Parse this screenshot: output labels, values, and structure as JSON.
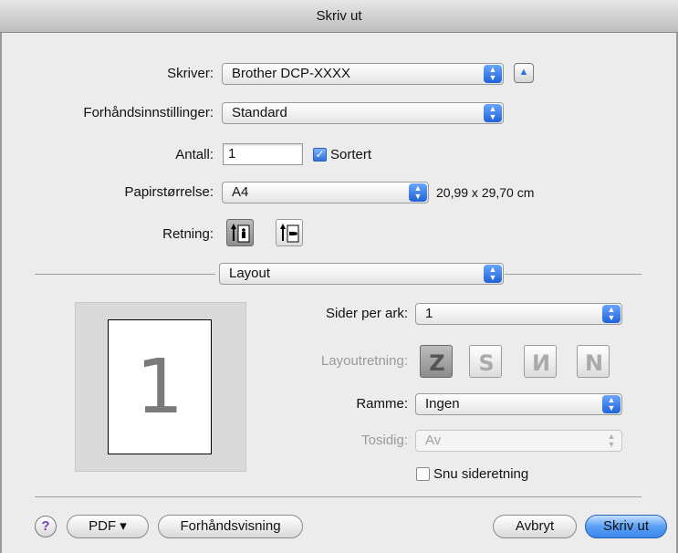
{
  "window": {
    "title": "Skriv ut"
  },
  "printer": {
    "label": "Skriver:",
    "value": "Brother DCP-XXXX"
  },
  "presets": {
    "label": "Forhåndsinnstillinger:",
    "value": "Standard"
  },
  "copies": {
    "label": "Antall:",
    "value": "1",
    "collate_label": "Sortert",
    "collated": true
  },
  "paper_size": {
    "label": "Papirstørrelse:",
    "value": "A4",
    "dimensions": "20,99 x 29,70 cm"
  },
  "orientation": {
    "label": "Retning:",
    "selected": "portrait"
  },
  "section": {
    "value": "Layout"
  },
  "pages_per_sheet": {
    "label": "Sider per ark:",
    "value": "1"
  },
  "layout_direction": {
    "label": "Layoutretning:",
    "selected_index": 0
  },
  "border": {
    "label": "Ramme:",
    "value": "Ingen"
  },
  "two_sided": {
    "label": "Tosidig:",
    "value": "Av"
  },
  "reverse_orientation": {
    "label": "Snu sideretning",
    "checked": false
  },
  "preview": {
    "page_number": "1"
  },
  "footer": {
    "help": "?",
    "pdf": "PDF ▾",
    "preview": "Forhåndsvisning",
    "cancel": "Avbryt",
    "print": "Skriv ut"
  },
  "icons": {
    "popup_arrow": "up-down-chevron-icon",
    "disclosure": "disclosure-triangle-up-icon",
    "orientation_portrait": "portrait-orientation-icon",
    "orientation_landscape": "landscape-orientation-icon",
    "help": "help-icon"
  }
}
